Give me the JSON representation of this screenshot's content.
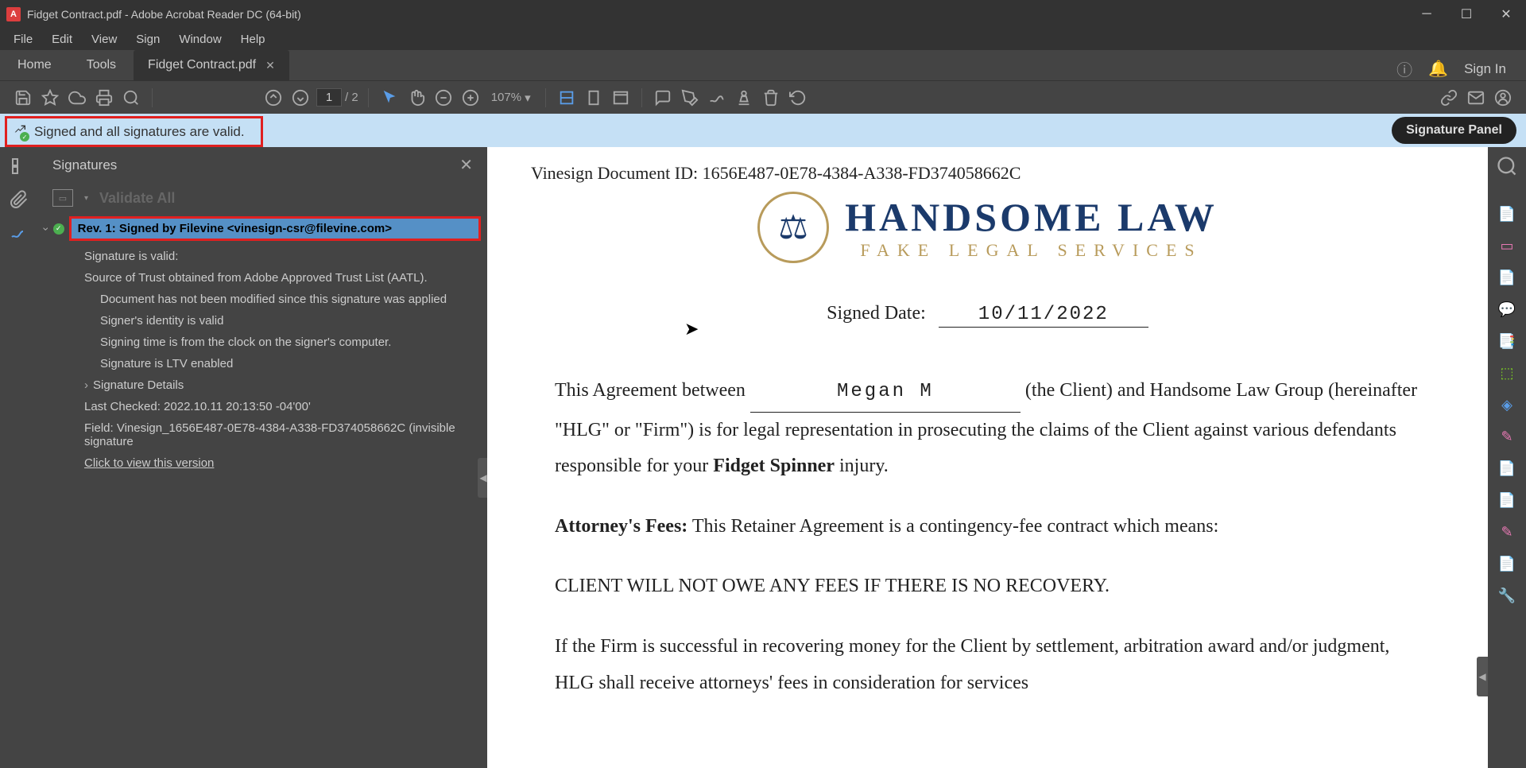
{
  "window": {
    "title": "Fidget Contract.pdf - Adobe Acrobat Reader DC (64-bit)"
  },
  "menubar": {
    "file": "File",
    "edit": "Edit",
    "view": "View",
    "sign": "Sign",
    "window": "Window",
    "help": "Help"
  },
  "tabs": {
    "home": "Home",
    "tools": "Tools",
    "doc": "Fidget Contract.pdf",
    "signin": "Sign In"
  },
  "toolbar": {
    "page_current": "1",
    "page_total": "/ 2",
    "zoom": "107%"
  },
  "sigbar": {
    "text": "Signed and all signatures are valid.",
    "panel_btn": "Signature Panel"
  },
  "sigpanel": {
    "title": "Signatures",
    "validate": "Validate All",
    "rev": "Rev. 1: Signed by Filevine <vinesign-csr@filevine.com>",
    "d1": "Signature is valid:",
    "d2": "Source of Trust obtained from Adobe Approved Trust List (AATL).",
    "d3": "Document has not been modified since this signature was applied",
    "d4": "Signer's identity is valid",
    "d5": "Signing time is from the clock on the signer's computer.",
    "d6": "Signature is LTV enabled",
    "d7": "Signature Details",
    "d8": "Last Checked: 2022.10.11 20:13:50 -04'00'",
    "d9": "Field: Vinesign_1656E487-0E78-4384-A338-FD374058662C (invisible signature",
    "d10": "Click to view this version"
  },
  "doc": {
    "docid": "Vinesign Document ID: 1656E487-0E78-4384-A338-FD374058662C",
    "lawtitle": "HANDSOME LAW",
    "lawsub": "FAKE LEGAL SERVICES",
    "signed_label": "Signed Date:",
    "signed_date": "10/11/2022",
    "p1a": "This Agreement between ",
    "client": "Megan M",
    "p1b": " (the Client) and Handsome Law Group (hereinafter \"HLG\" or \"Firm\") is for legal representation in prosecuting the claims of the Client against various defendants responsible for your ",
    "bold1": "Fidget Spinner",
    "p1c": " injury.",
    "p2label": "Attorney's Fees:",
    "p2": " This Retainer Agreement is a contingency-fee contract which means:",
    "p3": "CLIENT WILL NOT OWE ANY FEES IF THERE IS NO RECOVERY.",
    "p4": "If the Firm is successful in recovering money for the Client by settlement, arbitration award and/or judgment, HLG shall receive attorneys' fees in consideration for services"
  }
}
